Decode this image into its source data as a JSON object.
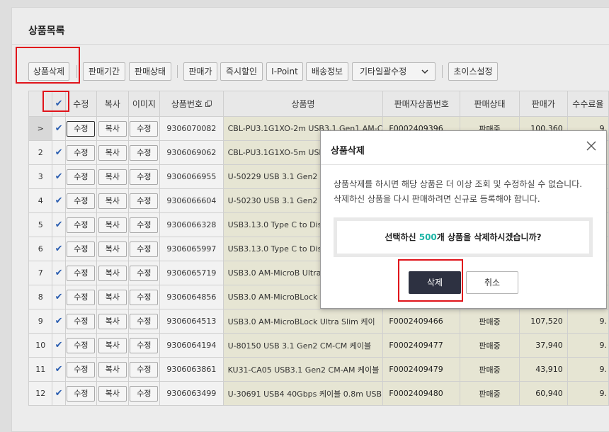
{
  "section_title": "상품목록",
  "toolbar": {
    "delete_product": "상품삭제",
    "sale_period": "판매기간",
    "sale_status": "판매상태",
    "sale_price": "판매가",
    "instant_discount": "즉시할인",
    "ipoint": "I-Point",
    "shipping_info": "배송정보",
    "bulk_edit_select": "기타일괄수정",
    "choice_settings": "초이스설정"
  },
  "table": {
    "headers": {
      "edit": "수정",
      "copy": "복사",
      "image": "이미지",
      "product_no": "상품번호",
      "product_name": "상품명",
      "seller_product_no": "판매자상품번호",
      "sale_status": "판매상태",
      "price": "판매가",
      "fee_rate": "수수료율"
    },
    "buttons": {
      "edit": "수정",
      "copy": "복사",
      "image": "수정"
    },
    "active_row_marker": ">",
    "rows": [
      {
        "num": "",
        "product_no": "9306070082",
        "name": "CBL-PU3.1G1XO-2m USB3.1 Gen1 AM-C",
        "seller_no": "F0002409396",
        "status": "판매중",
        "price": "100,360",
        "fee": "9."
      },
      {
        "num": "2",
        "product_no": "9306069062",
        "name": "CBL-PU3.1G1XO-5m USB",
        "seller_no": "",
        "status": "",
        "price": "",
        "fee": ""
      },
      {
        "num": "3",
        "product_no": "9306066955",
        "name": "U-50229 USB 3.1 Gen2 C",
        "seller_no": "",
        "status": "",
        "price": "",
        "fee": ""
      },
      {
        "num": "4",
        "product_no": "9306066604",
        "name": "U-50230 USB 3.1 Gen2 C",
        "seller_no": "",
        "status": "",
        "price": "",
        "fee": ""
      },
      {
        "num": "5",
        "product_no": "9306066328",
        "name": "USB3.13.0 Type C to Dis",
        "seller_no": "",
        "status": "",
        "price": "",
        "fee": ""
      },
      {
        "num": "6",
        "product_no": "9306065997",
        "name": "USB3.13.0 Type C to Dis",
        "seller_no": "",
        "status": "",
        "price": "",
        "fee": ""
      },
      {
        "num": "7",
        "product_no": "9306065719",
        "name": "USB3.0 AM-MicroB Ultra",
        "seller_no": "",
        "status": "",
        "price": "",
        "fee": ""
      },
      {
        "num": "8",
        "product_no": "9306064856",
        "name": "USB3.0 AM-MicroBLock",
        "seller_no": "",
        "status": "",
        "price": "",
        "fee": ""
      },
      {
        "num": "9",
        "product_no": "9306064513",
        "name": "USB3.0 AM-MicroBLock Ultra Slim 케이",
        "seller_no": "F0002409466",
        "status": "판매중",
        "price": "107,520",
        "fee": "9."
      },
      {
        "num": "10",
        "product_no": "9306064194",
        "name": "U-80150 USB 3.1 Gen2 CM-CM 케이블",
        "seller_no": "F0002409477",
        "status": "판매중",
        "price": "37,940",
        "fee": "9."
      },
      {
        "num": "11",
        "product_no": "9306063861",
        "name": "KU31-CA05 USB3.1 Gen2 CM-AM 케이블",
        "seller_no": "F0002409479",
        "status": "판매중",
        "price": "43,910",
        "fee": "9."
      },
      {
        "num": "12",
        "product_no": "9306063499",
        "name": "U-30691 USB4 40Gbps 케이블 0.8m USB",
        "seller_no": "F0002409480",
        "status": "판매중",
        "price": "60,940",
        "fee": "9."
      }
    ]
  },
  "modal": {
    "title": "상품삭제",
    "message_line1": "상품삭제를 하시면 해당 상품은 더 이상 조회 및 수정하실 수 없습니다.",
    "message_line2": "삭제하신 상품을 다시 판매하려면 신규로 등록해야 합니다.",
    "confirm_prefix": "선택하신 ",
    "confirm_count": "500",
    "confirm_suffix": "개 상품을 삭제하시겠습니까?",
    "delete_label": "삭제",
    "cancel_label": "취소"
  },
  "colors": {
    "highlight_red": "#e0141b",
    "count_teal": "#1cb5a6",
    "primary_dark": "#2d3141",
    "checkmark_blue": "#2a5db0"
  }
}
